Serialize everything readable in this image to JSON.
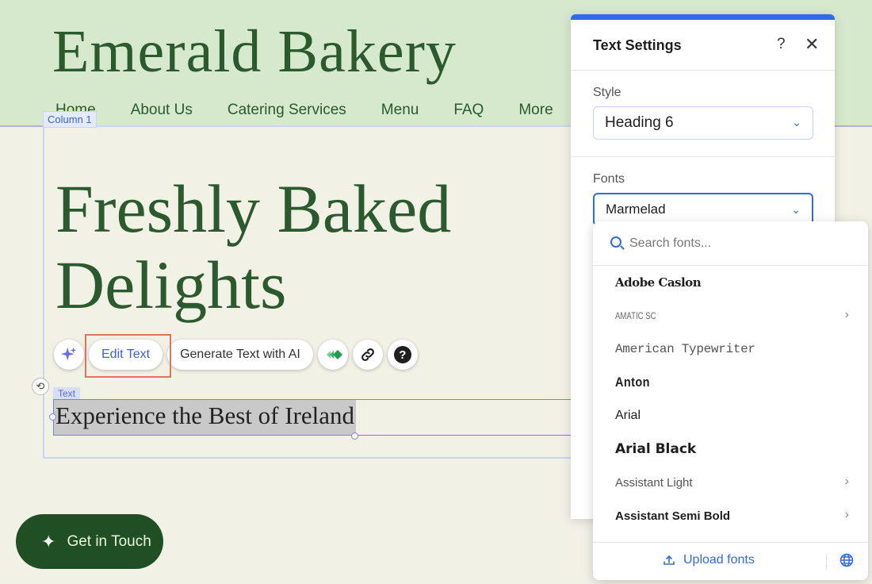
{
  "site": {
    "title": "Emerald Bakery",
    "nav": [
      "Home",
      "About Us",
      "Catering Services",
      "Menu",
      "FAQ",
      "More"
    ]
  },
  "editor": {
    "column_tag": "Column 1",
    "text_tag": "Text",
    "hero_title": "Freshly Baked Delights",
    "selected_text": "Experience the Best of Ireland",
    "toolbar": {
      "ai_icon": "sparkle-icon",
      "edit_text": "Edit Text",
      "generate_ai": "Generate Text with AI",
      "animation_icon": "animation-icon",
      "link_icon": "link-icon",
      "help_icon": "help-icon",
      "help_glyph": "?"
    },
    "undo_icon": "rotate-icon"
  },
  "cta": {
    "label": "Get in Touch",
    "icon": "sparkle-icon"
  },
  "panel": {
    "title": "Text Settings",
    "help": "?",
    "close": "✕",
    "style_label": "Style",
    "style_value": "Heading 6",
    "fonts_label": "Fonts",
    "fonts_value": "Marmelad"
  },
  "font_dropdown": {
    "search_placeholder": "Search fonts...",
    "fonts": [
      {
        "name": "Adobe Caslon",
        "has_submenu": false
      },
      {
        "name": "Amatic SC",
        "has_submenu": true
      },
      {
        "name": "American Typewriter",
        "has_submenu": false
      },
      {
        "name": "Anton",
        "has_submenu": false
      },
      {
        "name": "Arial",
        "has_submenu": false
      },
      {
        "name": "Arial Black",
        "has_submenu": false
      },
      {
        "name": "Assistant Light",
        "has_submenu": true
      },
      {
        "name": "Assistant Semi Bold",
        "has_submenu": true
      }
    ],
    "upload_label": "Upload fonts"
  },
  "colors": {
    "header_bg": "#d6e9cd",
    "brand_green": "#2a5a2d",
    "cta_bg": "#1f4f22",
    "accent_blue": "#2f6be8",
    "highlight_red": "#e2735d"
  }
}
